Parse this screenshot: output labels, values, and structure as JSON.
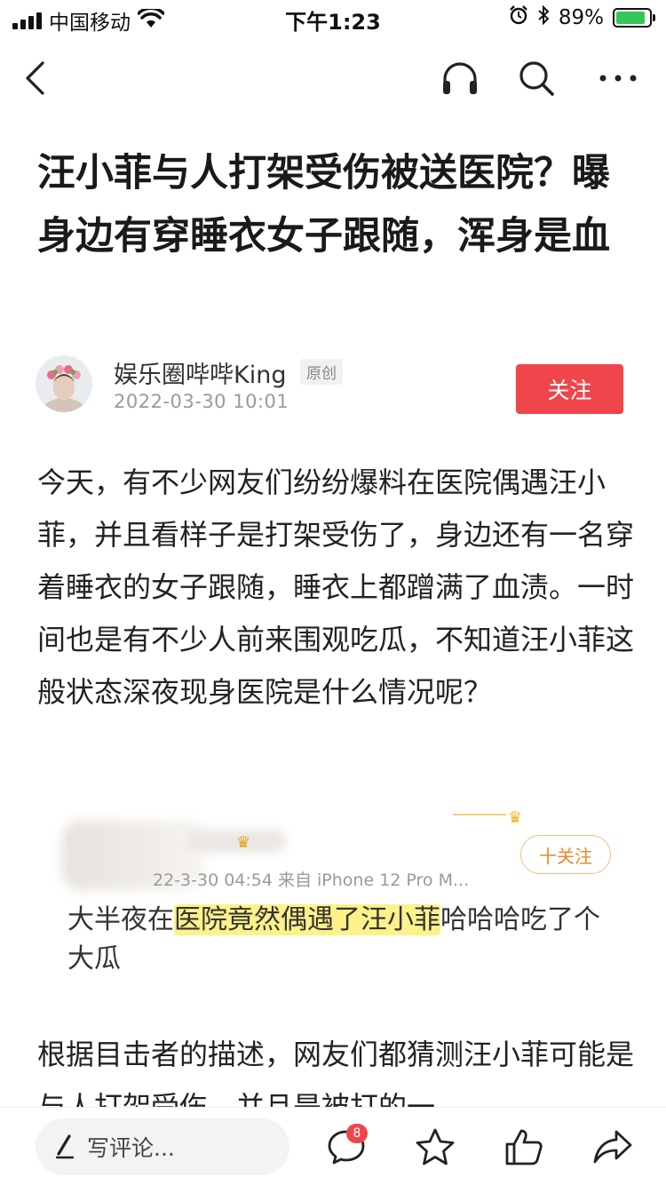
{
  "status_bar": {
    "carrier": "中国移动",
    "time": "下午1:23",
    "battery_percent": "89%",
    "battery_level": 0.89,
    "icons": [
      "signal-icon",
      "wifi-icon",
      "alarm-icon",
      "bluetooth-icon",
      "battery-charging-icon"
    ]
  },
  "nav": {
    "icons": [
      "back-arrow-icon",
      "headphones-icon",
      "search-icon",
      "more-icon"
    ]
  },
  "article": {
    "title": "汪小菲与人打架受伤被送医院？曝身边有穿睡衣女子跟随，浑身是血",
    "author": {
      "name": "娱乐圈哔哔King",
      "badge": "原创",
      "publish_time": "2022-03-30 10:01",
      "follow_label": "关注"
    },
    "paragraphs": [
      "今天，有不少网友们纷纷爆料在医院偶遇汪小菲，并且看样子是打架受伤了，身边还有一名穿着睡衣的女子跟随，睡衣上都蹭满了血渍。一时间也是有不少人前来围观吃瓜，不知道汪小菲这般状态深夜现身医院是什么情况呢？",
      "根据目击者的描述，网友们都猜测汪小菲可能是与人打架受伤，并且是被打的一"
    ],
    "embed": {
      "meta": "22-3-30 04:54  来自 iPhone 12 Pro M...",
      "follow_label": "十关注",
      "text_before": "大半夜在",
      "text_highlight": "医院竟然偶遇了汪小菲",
      "text_after": "哈哈哈吃了个大瓜",
      "highlight_color": "#fdf28a"
    }
  },
  "bottom_bar": {
    "comment_placeholder": "写评论...",
    "comment_count": "8",
    "icons": [
      "pen-icon",
      "comment-icon",
      "star-icon",
      "thumbs-up-icon",
      "share-icon"
    ]
  },
  "colors": {
    "accent": "#f0454a",
    "battery_green": "#34c759"
  }
}
